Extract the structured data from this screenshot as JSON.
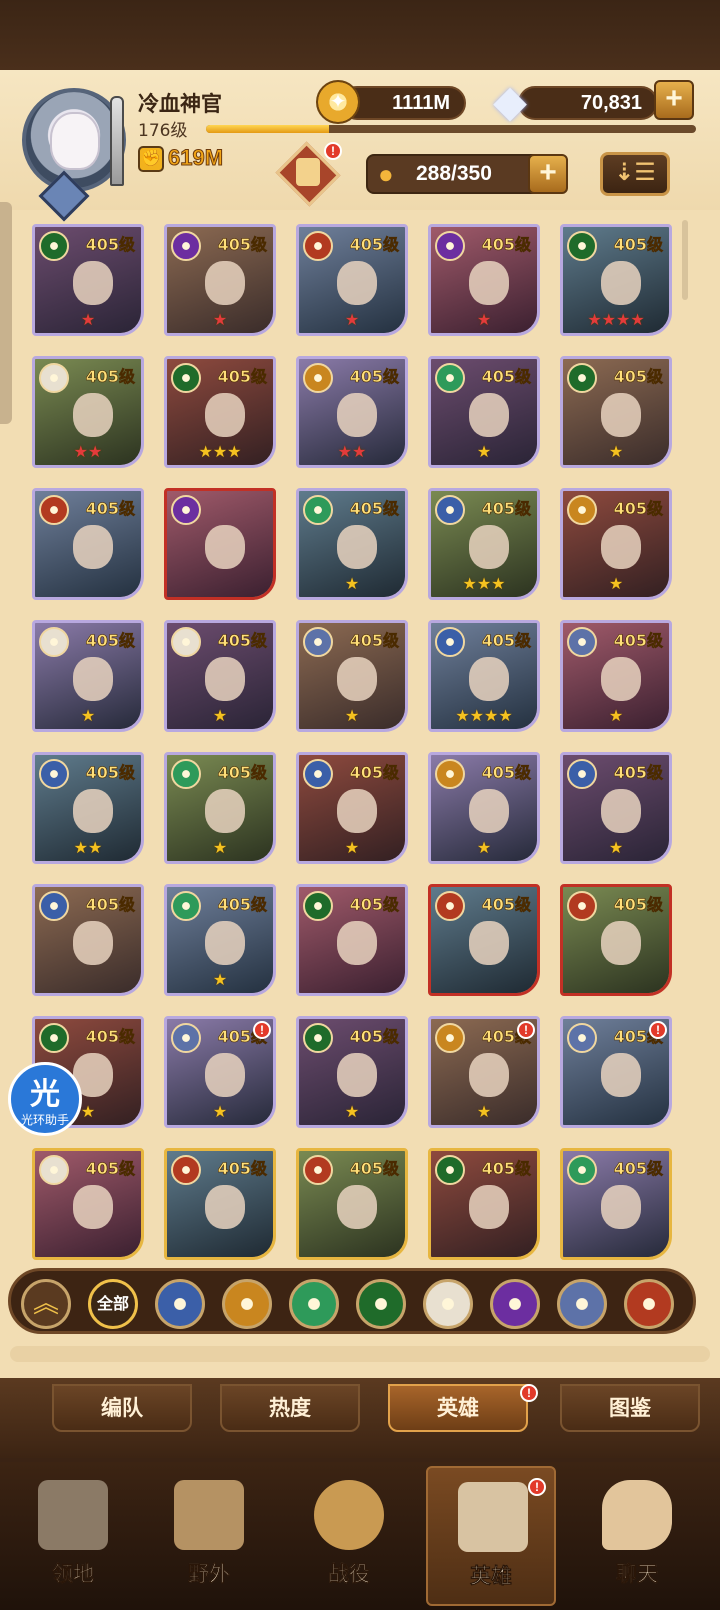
{
  "player": {
    "name": "冷血神官",
    "level": "176级",
    "xp_fraction": 0.25,
    "power": "619M"
  },
  "resources": {
    "gold": "1111M",
    "diamonds": "70,831"
  },
  "roster": {
    "count": "288/350"
  },
  "colors": {
    "panel": "#f2ddb3",
    "frame_dark": "#3d2413",
    "level_text": "#ffe07a",
    "star_gold": "#f5c220",
    "star_red": "#e33b3b"
  },
  "heroes": [
    {
      "level": "405级",
      "stars": "★",
      "star_color": "red",
      "frame": "purple",
      "faction": "wild",
      "alert": false
    },
    {
      "level": "405级",
      "stars": "★",
      "star_color": "red",
      "frame": "purple",
      "faction": "hypogean",
      "alert": false
    },
    {
      "level": "405级",
      "stars": "★",
      "star_color": "red",
      "frame": "purple",
      "faction": "graveborn",
      "alert": false
    },
    {
      "level": "405级",
      "stars": "★",
      "star_color": "red",
      "frame": "purple",
      "faction": "hypogean",
      "alert": false
    },
    {
      "level": "405级",
      "stars": "★★★★",
      "star_color": "red",
      "frame": "purple",
      "faction": "wild",
      "alert": false
    },
    {
      "level": "405级",
      "stars": "★★",
      "star_color": "red",
      "frame": "purple",
      "faction": "celestial",
      "alert": false
    },
    {
      "level": "405级",
      "stars": "★★★",
      "star_color": "gold",
      "frame": "purple",
      "faction": "wild",
      "alert": false
    },
    {
      "level": "405级",
      "stars": "★★",
      "star_color": "red",
      "frame": "purple",
      "faction": "mauler",
      "alert": false
    },
    {
      "level": "405级",
      "stars": "★",
      "star_color": "gold",
      "frame": "purple",
      "faction": "maulergreen",
      "alert": false
    },
    {
      "level": "405级",
      "stars": "★",
      "star_color": "gold",
      "frame": "purple",
      "faction": "wild",
      "alert": false
    },
    {
      "level": "405级",
      "stars": "",
      "star_color": "gold",
      "frame": "purple",
      "faction": "graveborn",
      "alert": false
    },
    {
      "level": "",
      "stars": "",
      "star_color": "gold",
      "frame": "red",
      "faction": "hypogean",
      "alert": false
    },
    {
      "level": "405级",
      "stars": "★",
      "star_color": "gold",
      "frame": "purple",
      "faction": "maulergreen",
      "alert": false
    },
    {
      "level": "405级",
      "stars": "★★★",
      "star_color": "gold",
      "frame": "purple",
      "faction": "lightbearer",
      "alert": false
    },
    {
      "level": "405级",
      "stars": "★",
      "star_color": "gold",
      "frame": "purple",
      "faction": "mauler",
      "alert": false
    },
    {
      "level": "405级",
      "stars": "★",
      "star_color": "gold",
      "frame": "purple",
      "faction": "celestial",
      "alert": false
    },
    {
      "level": "405级",
      "stars": "★",
      "star_color": "gold",
      "frame": "purple",
      "faction": "celestial",
      "alert": false
    },
    {
      "level": "405级",
      "stars": "★",
      "star_color": "gold",
      "frame": "purple",
      "faction": "dimensional",
      "alert": false
    },
    {
      "level": "405级",
      "stars": "★★★★",
      "star_color": "gold",
      "frame": "purple",
      "faction": "lightbearer",
      "alert": false
    },
    {
      "level": "405级",
      "stars": "★",
      "star_color": "gold",
      "frame": "purple",
      "faction": "dimensional",
      "alert": false
    },
    {
      "level": "405级",
      "stars": "★★",
      "star_color": "gold",
      "frame": "purple",
      "faction": "lightbearer",
      "alert": false
    },
    {
      "level": "405级",
      "stars": "★",
      "star_color": "gold",
      "frame": "purple",
      "faction": "maulergreen",
      "alert": false
    },
    {
      "level": "405级",
      "stars": "★",
      "star_color": "gold",
      "frame": "purple",
      "faction": "lightbearer",
      "alert": false
    },
    {
      "level": "405级",
      "stars": "★",
      "star_color": "gold",
      "frame": "purple",
      "faction": "mauler",
      "alert": false
    },
    {
      "level": "405级",
      "stars": "★",
      "star_color": "gold",
      "frame": "purple",
      "faction": "lightbearer",
      "alert": false
    },
    {
      "level": "405级",
      "stars": "",
      "star_color": "gold",
      "frame": "purple",
      "faction": "lightbearer",
      "alert": false
    },
    {
      "level": "405级",
      "stars": "★",
      "star_color": "gold",
      "frame": "purple",
      "faction": "maulergreen",
      "alert": false
    },
    {
      "level": "405级",
      "stars": "",
      "star_color": "gold",
      "frame": "purple",
      "faction": "wild",
      "alert": false
    },
    {
      "level": "405级",
      "stars": "",
      "star_color": "gold",
      "frame": "red",
      "faction": "graveborn",
      "alert": false
    },
    {
      "level": "405级",
      "stars": "",
      "star_color": "gold",
      "frame": "red",
      "faction": "graveborn",
      "alert": false
    },
    {
      "level": "405级",
      "stars": "★",
      "star_color": "gold",
      "frame": "purple",
      "faction": "wild",
      "alert": false
    },
    {
      "level": "405级",
      "stars": "★",
      "star_color": "gold",
      "frame": "purple",
      "faction": "dimensional",
      "alert": true
    },
    {
      "level": "405级",
      "stars": "★",
      "star_color": "gold",
      "frame": "purple",
      "faction": "wild",
      "alert": false
    },
    {
      "level": "405级",
      "stars": "★",
      "star_color": "gold",
      "frame": "purple",
      "faction": "mauler",
      "alert": true
    },
    {
      "level": "405级",
      "stars": "",
      "star_color": "gold",
      "frame": "purple",
      "faction": "dimensional",
      "alert": true
    },
    {
      "level": "405级",
      "stars": "",
      "star_color": "gold",
      "frame": "gold",
      "faction": "celestial",
      "alert": false
    },
    {
      "level": "405级",
      "stars": "",
      "star_color": "gold",
      "frame": "gold",
      "faction": "graveborn",
      "alert": false
    },
    {
      "level": "405级",
      "stars": "",
      "star_color": "gold",
      "frame": "gold",
      "faction": "graveborn",
      "alert": false
    },
    {
      "level": "405级",
      "stars": "",
      "star_color": "gold",
      "frame": "gold",
      "faction": "wild",
      "alert": false
    },
    {
      "level": "405级",
      "stars": "",
      "star_color": "gold",
      "frame": "gold",
      "faction": "maulergreen",
      "alert": false
    }
  ],
  "faction_filters": [
    {
      "name": "collapse-filter",
      "label": ""
    },
    {
      "name": "all",
      "label": "全部"
    },
    {
      "name": "lightbearer",
      "label": ""
    },
    {
      "name": "mauler",
      "label": ""
    },
    {
      "name": "maulergreen",
      "label": ""
    },
    {
      "name": "wild",
      "label": ""
    },
    {
      "name": "celestial",
      "label": ""
    },
    {
      "name": "hypogean",
      "label": ""
    },
    {
      "name": "dimensional",
      "label": ""
    },
    {
      "name": "graveborn",
      "label": ""
    }
  ],
  "sub_tabs": [
    "编队",
    "热度",
    "英雄",
    "图鉴"
  ],
  "bottom_nav": [
    "领地",
    "野外",
    "战役",
    "英雄",
    "聊天"
  ],
  "helper": {
    "glyph": "光",
    "label": "光环助手"
  }
}
